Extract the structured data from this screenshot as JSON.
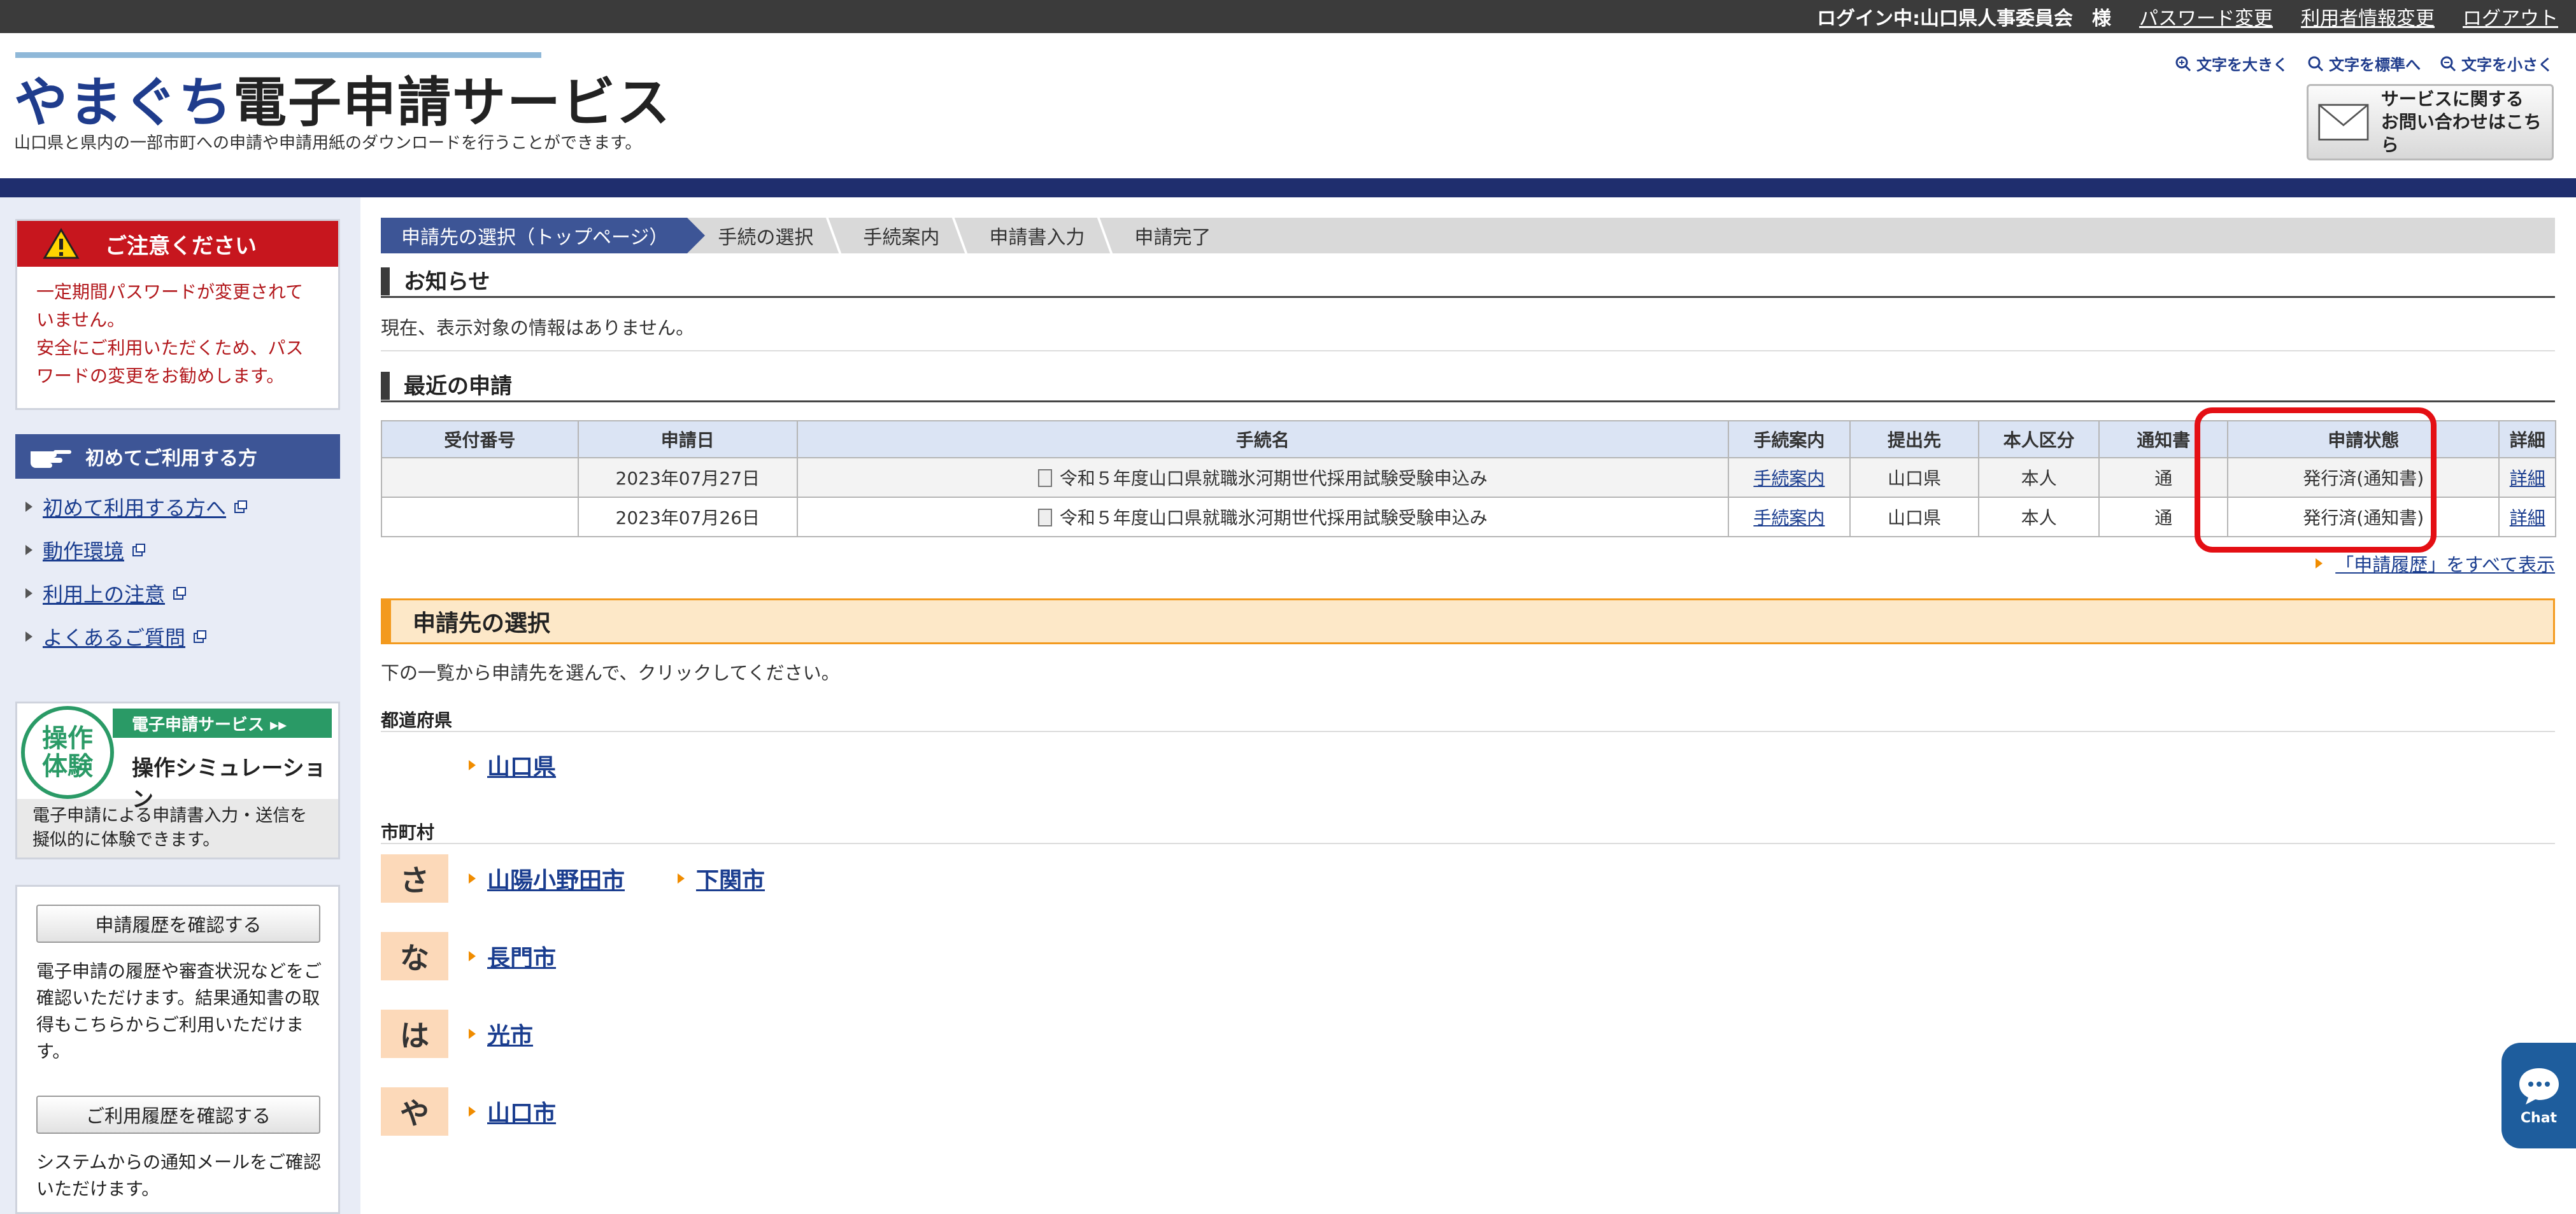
{
  "topbar": {
    "login_text": "ログイン中:山口県人事委員会　様",
    "links": [
      "パスワード変更",
      "利用者情報変更",
      "ログアウト"
    ]
  },
  "header": {
    "logo_a": "やまぐち",
    "logo_b": "電子申請サービス",
    "tagline": "山口県と県内の一部市町への申請や申請用紙のダウンロードを行うことができます。",
    "font_sizes": [
      "文字を大きく",
      "文字を標準へ",
      "文字を小さく"
    ],
    "contact_line1": "サービスに関する",
    "contact_line2": "お問い合わせはこちら"
  },
  "sidebar": {
    "caution_title": "ご注意ください",
    "caution_line1": "一定期間パスワードが変更されていません。",
    "caution_line2": "安全にご利用いただくため、パスワードの変更をお勧めします。",
    "firsttime_title": "初めてご利用する方",
    "links": [
      "初めて利用する方へ",
      "動作環境",
      "利用上の注意",
      "よくあるご質問"
    ],
    "sim_tag": "電子申請サービス ▸▸",
    "sim_circle_1": "操作",
    "sim_circle_2": "体験",
    "sim_title": "操作シミュレーション",
    "sim_desc": "電子申請による申請書入力・送信を擬似的に体験できます。",
    "history_btn": "申請履歴を確認する",
    "history_desc": "電子申請の履歴や審査状況などをご確認いただけます。結果通知書の取得もこちらからご利用いただけます。",
    "usage_btn": "ご利用履歴を確認する",
    "usage_desc": "システムからの通知メールをご確認いただけます。"
  },
  "main": {
    "breadcrumb": [
      "申請先の選択（トップページ）",
      "手続の選択",
      "手続案内",
      "申請書入力",
      "申請完了"
    ],
    "notice_title": "お知らせ",
    "notice_text": "現在、表示対象の情報はありません。",
    "recent_title": "最近の申請",
    "table": {
      "headers": [
        "受付番号",
        "申請日",
        "手続名",
        "手続案内",
        "提出先",
        "本人区分",
        "通知書",
        "申請状態",
        "詳細"
      ],
      "rows": [
        {
          "id": "",
          "date": "2023年07月27日",
          "name": "令和５年度山口県就職氷河期世代採用試験受験申込み",
          "guide": "手続案内",
          "dest": "山口県",
          "kind": "本人",
          "notice": "通",
          "status": "発行済(通知書)",
          "detail": "詳細"
        },
        {
          "id": "",
          "date": "2023年07月26日",
          "name": "令和５年度山口県就職氷河期世代採用試験受験申込み",
          "guide": "手続案内",
          "dest": "山口県",
          "kind": "本人",
          "notice": "通",
          "status": "発行済(通知書)",
          "detail": "詳細"
        }
      ]
    },
    "all_history": "「申請履歴」をすべて表示",
    "select_title": "申請先の選択",
    "select_text": "下の一覧から申請先を選んで、クリックしてください。",
    "pref_label": "都道府県",
    "pref_link": "山口県",
    "muni_label": "市町村",
    "kana": [
      "さ",
      "な",
      "は",
      "や"
    ],
    "muni_sa": [
      "山陽小野田市",
      "下関市"
    ],
    "muni_na": [
      "長門市"
    ],
    "muni_ha": [
      "光市"
    ],
    "muni_ya": [
      "山口市"
    ]
  },
  "chat_label": "Chat"
}
